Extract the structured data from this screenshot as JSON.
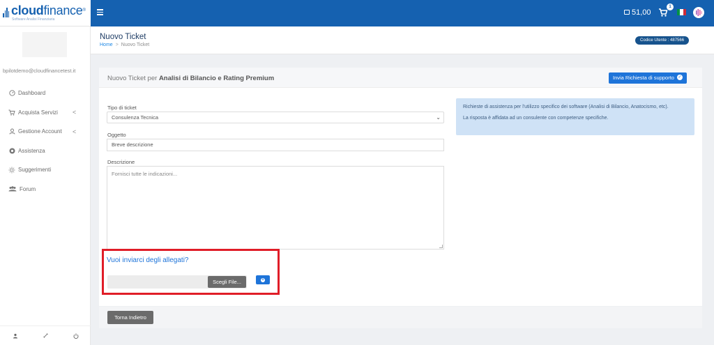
{
  "brand": {
    "name_bold": "cloud",
    "name_thin": "finance",
    "registered": "®",
    "tagline": "Software Analisi Finanziaria",
    "color": "#1561b0"
  },
  "topbar": {
    "credit": "51,00",
    "cart_count": "1",
    "icons": [
      "menu-icon",
      "credit-card-icon",
      "cart-icon",
      "italy-flag-icon",
      "avatar-icon"
    ]
  },
  "sidebar": {
    "email": "bpilotdemo@cloudfinancetest.it",
    "items": [
      {
        "label": "Dashboard",
        "icon": "dashboard-icon",
        "has_submenu": false
      },
      {
        "label": "Acquista Servizi",
        "icon": "cart-icon",
        "has_submenu": true
      },
      {
        "label": "Gestione Account",
        "icon": "user-icon",
        "has_submenu": true
      },
      {
        "label": "Assistenza",
        "icon": "lifebuoy-icon",
        "has_submenu": false
      },
      {
        "label": "Suggerimenti",
        "icon": "lightbulb-icon",
        "has_submenu": false
      },
      {
        "label": "Forum",
        "icon": "users-icon",
        "has_submenu": false
      }
    ],
    "chevron": "<",
    "footer_icons": [
      "user-icon",
      "settings-icon",
      "power-icon"
    ]
  },
  "header": {
    "title": "Nuovo Ticket",
    "breadcrumb": {
      "home": "Home",
      "separator": ">",
      "current": "Nuovo Ticket"
    },
    "user_code": "Codice Utente : 487566"
  },
  "card": {
    "title_prefix": "Nuovo Ticket per",
    "title_bold": "Analisi di Bilancio e Rating Premium",
    "support_button": "Invia Richiesta di supporto"
  },
  "form": {
    "ticket_type_label": "Tipo di ticket",
    "ticket_type_value": "Consulenza Tecnica",
    "subject_label": "Oggetto",
    "subject_value": "Breve descrizione",
    "description_label": "Descrizione",
    "description_placeholder": "Fornisci tutte le indicazioni...",
    "attachments_question": "Vuoi inviarci degli allegati?",
    "choose_file": "Scegli File..."
  },
  "info": {
    "line1": "Richieste di assistenza per l'utilizzo specifico dei software (Analisi di Bilancio, Anatocismo, etc).",
    "line2": "La risposta è affidata ad un consulente con competenze specifiche."
  },
  "footer": {
    "back_button": "Torna Indietro"
  },
  "colors": {
    "primary": "#1561b0",
    "button_blue": "#1e74d9",
    "highlight_red": "#e01d28",
    "info_bg": "#cfe2f6"
  }
}
